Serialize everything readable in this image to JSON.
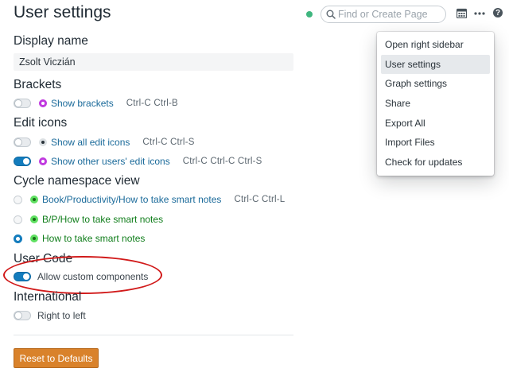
{
  "page": {
    "title": "User settings"
  },
  "header": {
    "search": {
      "placeholder": "Find or Create Page"
    },
    "icons": [
      "status-dot",
      "search-icon",
      "calendar-icon",
      "more-icon",
      "help-icon"
    ],
    "help_label": "?"
  },
  "menu": {
    "items": [
      {
        "label": "Open right sidebar",
        "active": false
      },
      {
        "label": "User settings",
        "active": true
      },
      {
        "label": "Graph settings",
        "active": false
      },
      {
        "label": "Share",
        "active": false
      },
      {
        "label": "Export All",
        "active": false
      },
      {
        "label": "Import Files",
        "active": false
      },
      {
        "label": "Check for updates",
        "active": false
      }
    ]
  },
  "display_name": {
    "heading": "Display name",
    "value": "Zsolt Viczián"
  },
  "brackets": {
    "heading": "Brackets",
    "show_brackets": {
      "label": "Show brackets",
      "keys": "Ctrl-C Ctrl-B",
      "on": false
    }
  },
  "edit_icons": {
    "heading": "Edit icons",
    "show_all": {
      "label": "Show all edit icons",
      "keys": "Ctrl-C Ctrl-S",
      "on": false
    },
    "show_other": {
      "label": "Show other users' edit icons",
      "keys": "Ctrl-C Ctrl-C Ctrl-S",
      "on": true
    }
  },
  "cycle_namespace": {
    "heading": "Cycle namespace view",
    "options": [
      {
        "label": "Book/Productivity/How to take smart notes",
        "keys": "Ctrl-C Ctrl-L",
        "selected": false
      },
      {
        "label": "B/P/How to take smart notes",
        "keys": "",
        "selected": false
      },
      {
        "label": "How to take smart notes",
        "keys": "",
        "selected": true
      }
    ]
  },
  "user_code": {
    "heading": "User Code",
    "allow_custom": {
      "label": "Allow custom components",
      "on": true
    }
  },
  "international": {
    "heading": "International",
    "rtl": {
      "label": "Right to left",
      "on": false
    }
  },
  "actions": {
    "reset_label": "Reset to Defaults"
  },
  "colors": {
    "accent": "#137cbd",
    "reset_button": "#d9822b",
    "annotation_circle": "#d11a1a",
    "status_dot": "#3fb67f"
  }
}
